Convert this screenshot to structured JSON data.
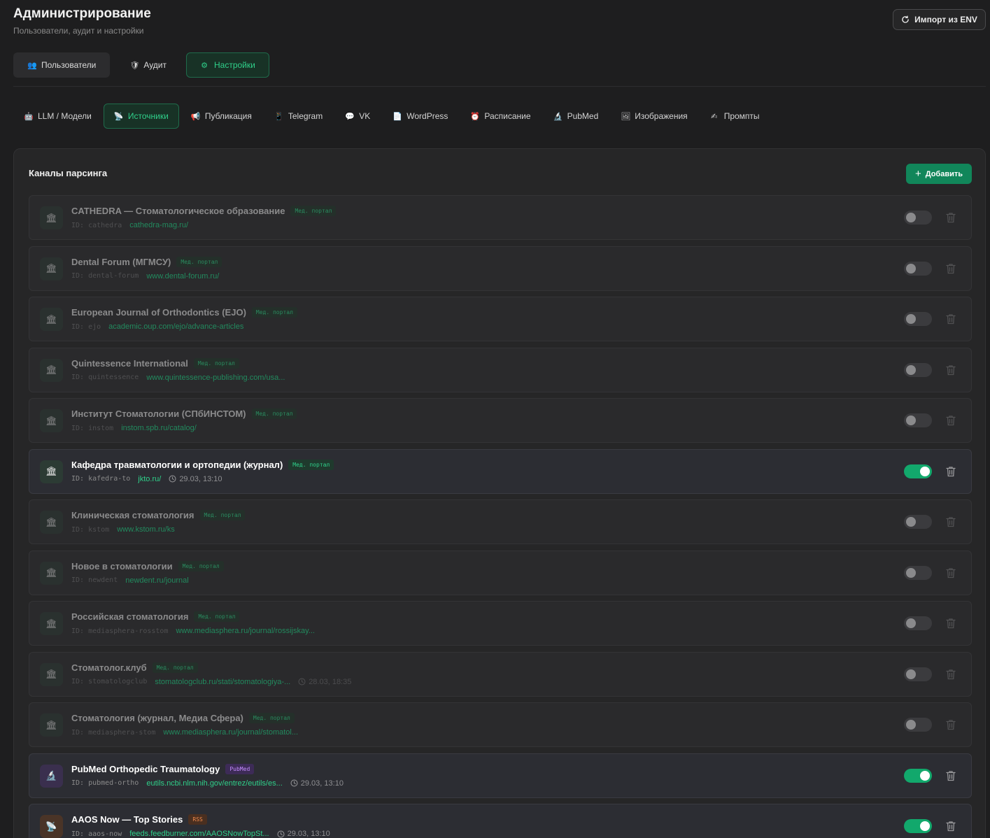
{
  "header": {
    "title": "Администрирование",
    "subtitle": "Пользователи, аудит и настройки",
    "import_label": "Импорт из ENV"
  },
  "main_tabs": [
    {
      "label": "Пользователи",
      "icon": "👥"
    },
    {
      "label": "Аудит",
      "icon": "🛡"
    },
    {
      "label": "Настройки",
      "icon": "⚙",
      "active": true
    }
  ],
  "sub_tabs": [
    {
      "label": "LLM / Модели",
      "icon": "🤖"
    },
    {
      "label": "Источники",
      "icon": "📡",
      "active": true
    },
    {
      "label": "Публикация",
      "icon": "📢"
    },
    {
      "label": "Telegram",
      "icon": "📱"
    },
    {
      "label": "VK",
      "icon": "💬"
    },
    {
      "label": "WordPress",
      "icon": "📄"
    },
    {
      "label": "Расписание",
      "icon": "⏰"
    },
    {
      "label": "PubMed",
      "icon": "🔬"
    },
    {
      "label": "Изображения",
      "icon": "🖼"
    },
    {
      "label": "Промпты",
      "icon": "✍"
    }
  ],
  "panel": {
    "title": "Каналы парсинга",
    "add_label": "Добавить"
  },
  "channels": [
    {
      "title": "CATHEDRA — Стоматологическое образование",
      "badge": "Мед. портал",
      "id": "ID: cathedra",
      "url": "cathedra-mag.ru/",
      "time": "",
      "enabled": false,
      "icon": "🏛"
    },
    {
      "title": "Dental Forum (МГМСУ)",
      "badge": "Мед. портал",
      "id": "ID: dental-forum",
      "url": "www.dental-forum.ru/",
      "time": "",
      "enabled": false,
      "icon": "🏛"
    },
    {
      "title": "European Journal of Orthodontics (EJO)",
      "badge": "Мед. портал",
      "id": "ID: ejo",
      "url": "academic.oup.com/ejo/advance-articles",
      "time": "",
      "enabled": false,
      "icon": "🏛"
    },
    {
      "title": "Quintessence International",
      "badge": "Мед. портал",
      "id": "ID: quintessence",
      "url": "www.quintessence-publishing.com/usa...",
      "time": "",
      "enabled": false,
      "icon": "🏛"
    },
    {
      "title": "Институт Стоматологии (СПбИНСТОМ)",
      "badge": "Мед. портал",
      "id": "ID: instom",
      "url": "instom.spb.ru/catalog/",
      "time": "",
      "enabled": false,
      "icon": "🏛"
    },
    {
      "title": "Кафедра травматологии и ортопедии (журнал)",
      "badge": "Мед. портал",
      "id": "ID: kafedra-to",
      "url": "jkto.ru/",
      "time": "29.03, 13:10",
      "enabled": true,
      "icon": "🏛"
    },
    {
      "title": "Клиническая стоматология",
      "badge": "Мед. портал",
      "id": "ID: kstom",
      "url": "www.kstom.ru/ks",
      "time": "",
      "enabled": false,
      "icon": "🏛"
    },
    {
      "title": "Новое в стоматологии",
      "badge": "Мед. портал",
      "id": "ID: newdent",
      "url": "newdent.ru/journal",
      "time": "",
      "enabled": false,
      "icon": "🏛"
    },
    {
      "title": "Российская стоматология",
      "badge": "Мед. портал",
      "id": "ID: mediasphera-rosstom",
      "url": "www.mediasphera.ru/journal/rossijskay...",
      "time": "",
      "enabled": false,
      "icon": "🏛"
    },
    {
      "title": "Стоматолог.клуб",
      "badge": "Мед. портал",
      "id": "ID: stomatologclub",
      "url": "stomatologclub.ru/stati/stomatologiya-...",
      "time": "28.03, 18:35",
      "enabled": false,
      "icon": "🏛"
    },
    {
      "title": "Стоматология (журнал, Медиа Сфера)",
      "badge": "Мед. портал",
      "id": "ID: mediasphera-stom",
      "url": "www.mediasphera.ru/journal/stomatol...",
      "time": "",
      "enabled": false,
      "icon": "🏛"
    },
    {
      "title": "PubMed Orthopedic Traumatology",
      "badge": "PubMed",
      "id": "ID: pubmed-ortho",
      "url": "eutils.ncbi.nlm.nih.gov/entrez/eutils/es...",
      "time": "29.03, 13:10",
      "enabled": true,
      "icon": "🔬",
      "kind": "pubmed"
    },
    {
      "title": "AAOS Now — Top Stories",
      "badge": "RSS",
      "id": "ID: aaos-now",
      "url": "feeds.feedburner.com/AAOSNowTopSt...",
      "time": "29.03, 13:10",
      "enabled": true,
      "icon": "📡",
      "kind": "rss"
    }
  ],
  "colors": {
    "background": "#1e1e1f",
    "accent": "#2fd08a",
    "button_green": "#11865a",
    "pubmed": "#c58cff",
    "rss": "#f08a4b"
  }
}
